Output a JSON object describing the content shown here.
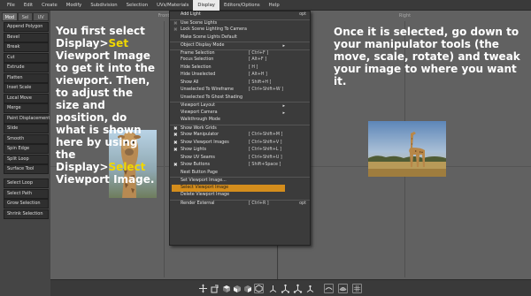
{
  "menubar": {
    "items": [
      "File",
      "Edit",
      "Create",
      "Modify",
      "Subdivision",
      "Selection",
      "UVs/Materials",
      "Display",
      "Editors/Options",
      "Help"
    ],
    "active": "Display"
  },
  "toolbox": {
    "tabs": [
      "Mod",
      "Sel",
      "UV"
    ],
    "tools": [
      "Append Polygon",
      "Bevel",
      "Break",
      "Cut",
      "Extrude",
      "Flatten",
      "Inset Scale",
      "Local Move",
      "Merge",
      "Paint Displacement",
      "Slide",
      "Smooth",
      "Spin Edge",
      "Split Loop",
      "Surface Tool"
    ],
    "select_tools": [
      "Select Loop",
      "Select Path",
      "Grow Selection",
      "Shrink Selection"
    ]
  },
  "viewports": {
    "front_label": "Front",
    "right_label": "Right"
  },
  "captions": {
    "left_part1": "You first select Display>",
    "left_set": "Set",
    "left_part2": " Viewport Image to get it into the viewport. Then, to adjust the size and position, do what is shown here by using the Display>",
    "left_select": "Select",
    "left_part3": " Viewport Image.",
    "right": "Once it is selected, go down to your manipulator tools (the move, scale, rotate) and tweak your image to where you want it."
  },
  "display_menu": {
    "add_light": "Add Light",
    "add_light_opt": "opt",
    "use_scene_lights": "Use Scene Lights",
    "lock_scene_lighting": "Lock Scene Lighting To Camera",
    "make_scene_lights_default": "Make Scene Lights Default",
    "object_display_mode": "Object Display Mode",
    "frame_selection": "Frame Selection",
    "frame_selection_sc": "[ Ctrl+F ]",
    "focus_selection": "Focus Selection",
    "focus_selection_sc": "[ Alt+F ]",
    "hide_selection": "Hide Selection",
    "hide_selection_sc": "[ H ]",
    "hide_unselected": "Hide Unselected",
    "hide_unselected_sc": "[ Alt+H ]",
    "show_all": "Show All",
    "show_all_sc": "[ Shift+H ]",
    "unselected_wireframe": "Unselected To Wireframe",
    "unselected_wireframe_sc": "[ Ctrl+Shift+W ]",
    "unselected_ghost": "Unselected To Ghost Shading",
    "viewport_layout": "Viewport Layout",
    "viewport_camera": "Viewport Camera",
    "walkthrough_mode": "Walkthrough Mode",
    "show_work_grids": "Show Work Grids",
    "show_manipulator": "Show Manipulator",
    "show_manipulator_sc": "[ Ctrl+Shift+M ]",
    "show_viewport_images": "Show Viewport Images",
    "show_viewport_images_sc": "[ Ctrl+Shift+V ]",
    "show_lights": "Show Lights",
    "show_lights_sc": "[ Ctrl+Shift+L ]",
    "show_uv_seams": "Show UV Seams",
    "show_uv_seams_sc": "[ Ctrl+Shift+U ]",
    "show_buttons": "Show Buttons",
    "show_buttons_sc": "[ Shift+Space ]",
    "next_button_page": "Next Button Page",
    "set_viewport_image": "Set Viewport Image...",
    "select_viewport_image": "Select Viewport Image",
    "delete_viewport_image": "Delete Viewport Image",
    "render_external": "Render External",
    "render_external_sc": "[ Ctrl+R ]",
    "render_external_opt": "opt",
    "submenu_arrow": "▸",
    "check": "✖",
    "highlight_color": "#d48d1c"
  },
  "bottombar": {
    "icons": [
      "move-tool-icon",
      "scale-tool-icon",
      "cube-top-icon",
      "cube-front-icon",
      "cube-side-icon",
      "cube-perspective-icon",
      "manipulator-axis-icon",
      "manipulator-scale-icon",
      "manipulator-rotate-icon",
      "manipulator-free-icon",
      "view-wire-icon",
      "view-smooth-icon",
      "view-grid-icon"
    ]
  }
}
